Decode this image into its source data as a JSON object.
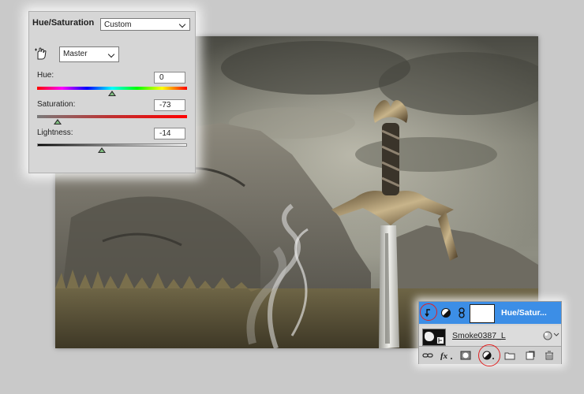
{
  "hue_saturation": {
    "title": "Hue/Saturation",
    "preset": "Custom",
    "channel": "Master",
    "hue_label": "Hue:",
    "hue_value": "0",
    "hue_fraction": 0.5,
    "saturation_label": "Saturation:",
    "saturation_value": "-73",
    "saturation_fraction": 0.135,
    "lightness_label": "Lightness:",
    "lightness_value": "-14",
    "lightness_fraction": 0.43
  },
  "layers": {
    "adjustment_layer_name": "Hue/Satur...",
    "smoke_layer_name": "Smoke0387_L",
    "selected_color": "#3c8ee6"
  },
  "icons": {
    "hand": "targeted-adjustment-hand-icon",
    "clip": "clip-to-layer-icon",
    "adjustment": "adjustment-layer-icon",
    "link": "link-icon",
    "fx": "fx-icon",
    "mask": "mask-icon",
    "new_adjustment": "new-adjustment-layer-icon",
    "group": "folder-icon",
    "new_layer": "new-layer-icon",
    "trash": "trash-icon"
  },
  "colors": {
    "panel_bg": "#d6d6d6",
    "highlight_circle": "#e02020"
  }
}
